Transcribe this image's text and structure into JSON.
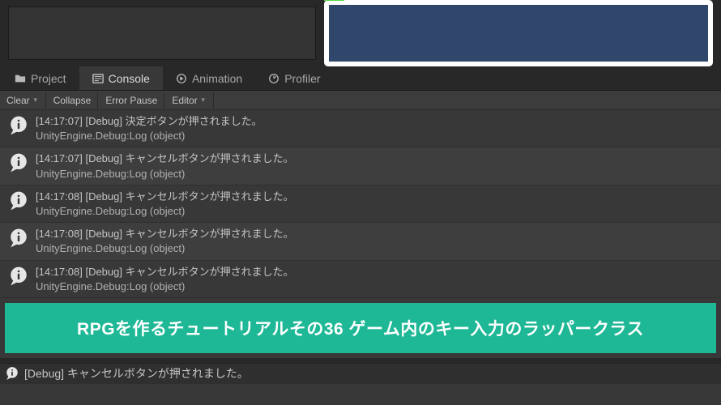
{
  "tabs": {
    "project": "Project",
    "console": "Console",
    "animation": "Animation",
    "profiler": "Profiler"
  },
  "toolbar": {
    "clear": "Clear",
    "collapse": "Collapse",
    "errorPause": "Error Pause",
    "editor": "Editor"
  },
  "logs": [
    {
      "timestamp": "[14:17:07]",
      "tag": "[Debug]",
      "message": "決定ボタンが押されました。",
      "source": "UnityEngine.Debug:Log (object)"
    },
    {
      "timestamp": "[14:17:07]",
      "tag": "[Debug]",
      "message": "キャンセルボタンが押されました。",
      "source": "UnityEngine.Debug:Log (object)"
    },
    {
      "timestamp": "[14:17:08]",
      "tag": "[Debug]",
      "message": "キャンセルボタンが押されました。",
      "source": "UnityEngine.Debug:Log (object)"
    },
    {
      "timestamp": "[14:17:08]",
      "tag": "[Debug]",
      "message": "キャンセルボタンが押されました。",
      "source": "UnityEngine.Debug:Log (object)"
    },
    {
      "timestamp": "[14:17:08]",
      "tag": "[Debug]",
      "message": "キャンセルボタンが押されました。",
      "source": "UnityEngine.Debug:Log (object)"
    }
  ],
  "banner": {
    "text": "RPGを作るチュートリアルその36 ゲーム内のキー入力のラッパークラス"
  },
  "statusBar": {
    "tag": "[Debug]",
    "message": "キャンセルボタンが押されました。"
  }
}
